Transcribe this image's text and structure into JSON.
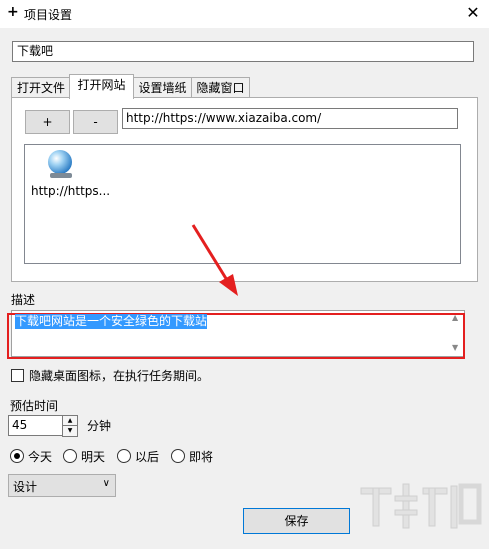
{
  "window": {
    "title": "项目设置",
    "close_label": "✕",
    "title_icon": "plus-icon"
  },
  "project_name": {
    "value": "下载吧"
  },
  "tabs": [
    {
      "label": "打开文件",
      "active": false
    },
    {
      "label": "打开网站",
      "active": true
    },
    {
      "label": "设置墙纸",
      "active": false
    },
    {
      "label": "隐藏窗口",
      "active": false
    }
  ],
  "website_tab": {
    "add_label": "+",
    "remove_label": "-",
    "url_value": "http://https://www.xiazaiba.com/",
    "list_items": [
      {
        "icon": "globe-icon",
        "label": "http://https..."
      }
    ]
  },
  "description": {
    "label": "描述",
    "value": "下载吧网站是一个安全绿色的下载站"
  },
  "hide_desktop_icons": {
    "label": "隐藏桌面图标，在执行任务期间。",
    "checked": false
  },
  "estimated_time": {
    "label": "预估时间",
    "value": "45",
    "unit": "分钟"
  },
  "day_options": [
    {
      "label": "今天",
      "selected": true
    },
    {
      "label": "明天",
      "selected": false
    },
    {
      "label": "以后",
      "selected": false
    },
    {
      "label": "即将",
      "selected": false
    }
  ],
  "category_select": {
    "value": "设计"
  },
  "save_label": "保存",
  "annotation": {
    "arrow_color": "#e41f1f"
  },
  "watermark": {
    "text": "下载吧"
  }
}
